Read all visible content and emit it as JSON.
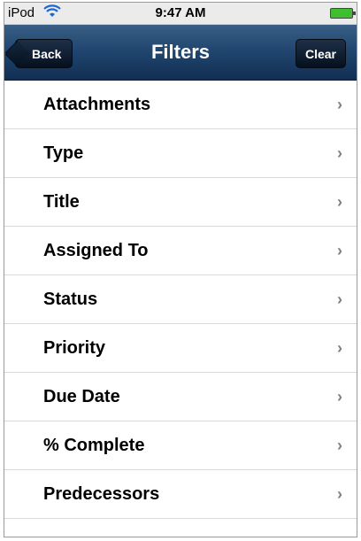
{
  "status_bar": {
    "carrier": "iPod",
    "time": "9:47 AM",
    "wifi_icon": "wifi-icon",
    "battery_icon": "battery-icon"
  },
  "nav_bar": {
    "title": "Filters",
    "back_label": "Back",
    "clear_label": "Clear"
  },
  "filters": {
    "items": [
      {
        "label": "Attachments",
        "chevron": "›"
      },
      {
        "label": "Type",
        "chevron": "›"
      },
      {
        "label": "Title",
        "chevron": "›"
      },
      {
        "label": "Assigned To",
        "chevron": "›"
      },
      {
        "label": "Status",
        "chevron": "›"
      },
      {
        "label": "Priority",
        "chevron": "›"
      },
      {
        "label": "Due Date",
        "chevron": "›"
      },
      {
        "label": "% Complete",
        "chevron": "›"
      },
      {
        "label": "Predecessors",
        "chevron": "›"
      }
    ]
  },
  "colors": {
    "navbar": "#214770",
    "battery": "#3fbf2f",
    "chevron": "#7f7f7f"
  }
}
